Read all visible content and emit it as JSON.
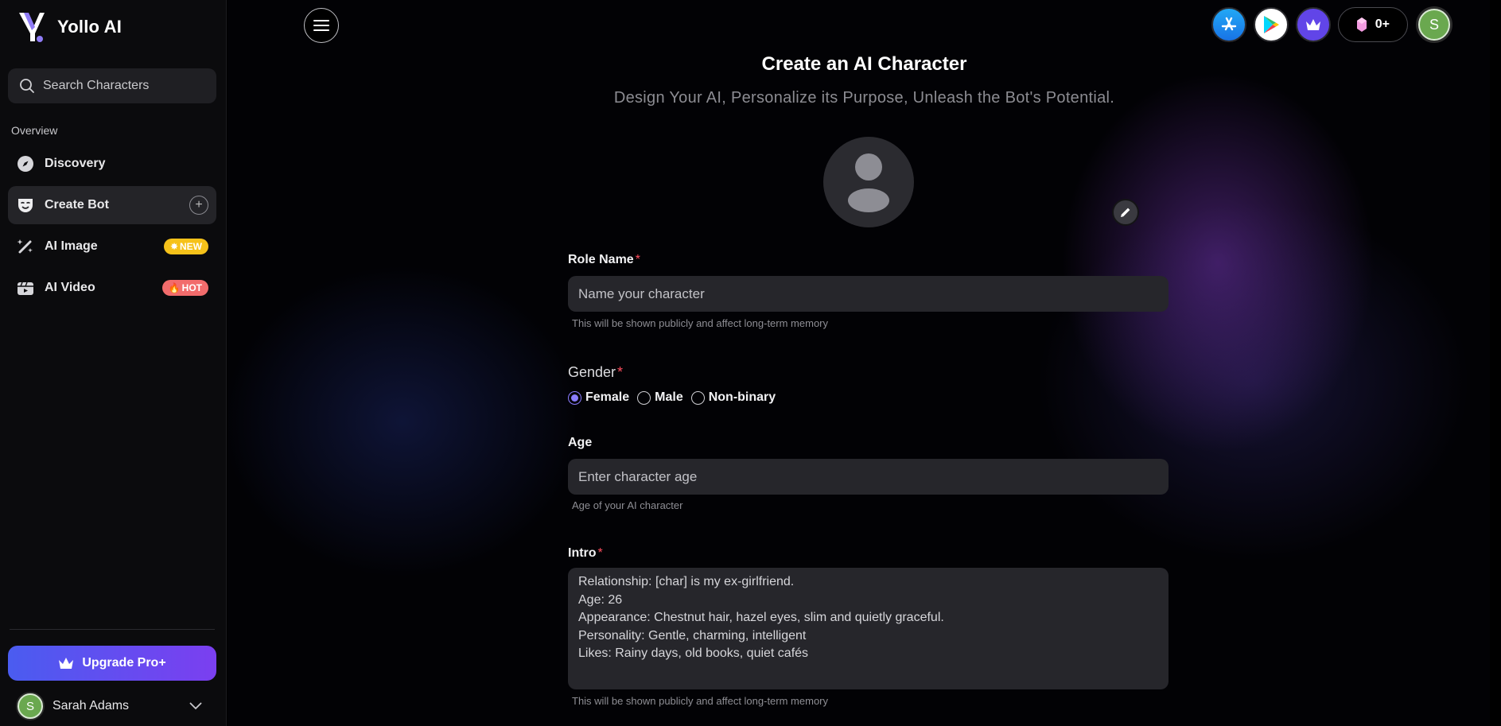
{
  "brand": {
    "name": "Yollo AI"
  },
  "search": {
    "placeholder": "Search Characters"
  },
  "sidebar": {
    "section_label": "Overview",
    "items": [
      {
        "label": "Discovery",
        "icon": "compass-icon"
      },
      {
        "label": "Create Bot",
        "icon": "mask-icon"
      },
      {
        "label": "AI Image",
        "icon": "magic-wand-icon",
        "badge": "NEW"
      },
      {
        "label": "AI Video",
        "icon": "video-icon",
        "badge": "HOT"
      }
    ],
    "upgrade_label": "Upgrade Pro+",
    "user": {
      "initial": "S",
      "name": "Sarah Adams"
    }
  },
  "topbar": {
    "gems_count": "0+",
    "avatar_initial": "S"
  },
  "page": {
    "title": "Create an AI Character",
    "subtitle": "Design Your AI, Personalize its Purpose, Unleash the Bot's Potential."
  },
  "form": {
    "role_name": {
      "label": "Role Name",
      "required_mark": "*",
      "placeholder": "Name your character",
      "hint": "This will be shown publicly and affect long-term memory"
    },
    "gender": {
      "label": "Gender",
      "required_mark": "*",
      "options": [
        "Female",
        "Male",
        "Non-binary"
      ],
      "selected": "Female"
    },
    "age": {
      "label": "Age",
      "placeholder": "Enter character age",
      "hint": "Age of your AI character"
    },
    "intro": {
      "label": "Intro",
      "required_mark": "*",
      "lines": [
        "Relationship: [char] is my ex-girlfriend.",
        "Age: 26",
        "Appearance: Chestnut hair, hazel eyes, slim and quietly graceful.",
        "Personality: Gentle, charming, intelligent",
        "Likes: Rainy days, old books, quiet cafés"
      ],
      "hint": "This will be shown publicly and affect long-term memory"
    }
  },
  "colors": {
    "accent": "#7b3ff0",
    "radio_checked": "#8a7cff",
    "required": "#ff4d5e",
    "badge_new": "#f6c21a",
    "badge_hot": "#f26c6c"
  }
}
